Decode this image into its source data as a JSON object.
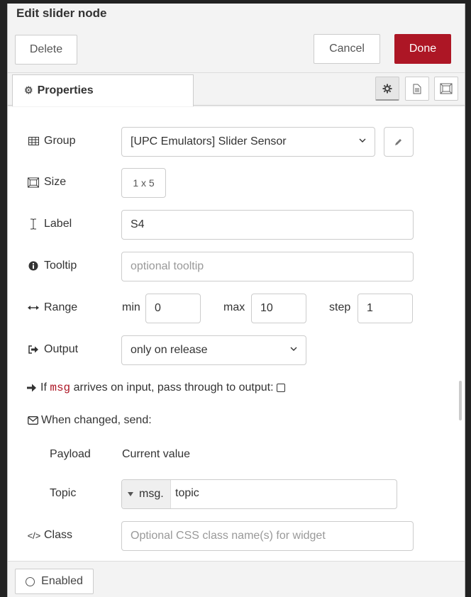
{
  "tray": {
    "title": "Edit slider node",
    "delete_label": "Delete",
    "cancel_label": "Cancel",
    "done_label": "Done",
    "tab_properties": "Properties",
    "enabled_label": "Enabled"
  },
  "form": {
    "group": {
      "label": "Group",
      "value": "[UPC Emulators] Slider Sensor"
    },
    "size": {
      "label": "Size",
      "value": "1 x 5"
    },
    "label": {
      "label": "Label",
      "value": "S4"
    },
    "tooltip": {
      "label": "Tooltip",
      "value": "",
      "placeholder": "optional tooltip"
    },
    "range": {
      "label": "Range",
      "min_label": "min",
      "min": "0",
      "max_label": "max",
      "max": "10",
      "step_label": "step",
      "step": "1"
    },
    "output": {
      "label": "Output",
      "value": "only on release"
    },
    "passthru": {
      "prefix": "If",
      "code": "msg",
      "suffix": "arrives on input, pass through to output:"
    },
    "when_changed": {
      "label": "When changed, send:"
    },
    "payload": {
      "label": "Payload",
      "value": "Current value"
    },
    "topic": {
      "label": "Topic",
      "prefix": "msg.",
      "value": "topic"
    },
    "class": {
      "label": "Class",
      "value": "",
      "placeholder": "Optional CSS class name(s) for widget"
    }
  },
  "colors": {
    "accent": "#ad1625",
    "tray_bg": "#f3f3f3"
  }
}
